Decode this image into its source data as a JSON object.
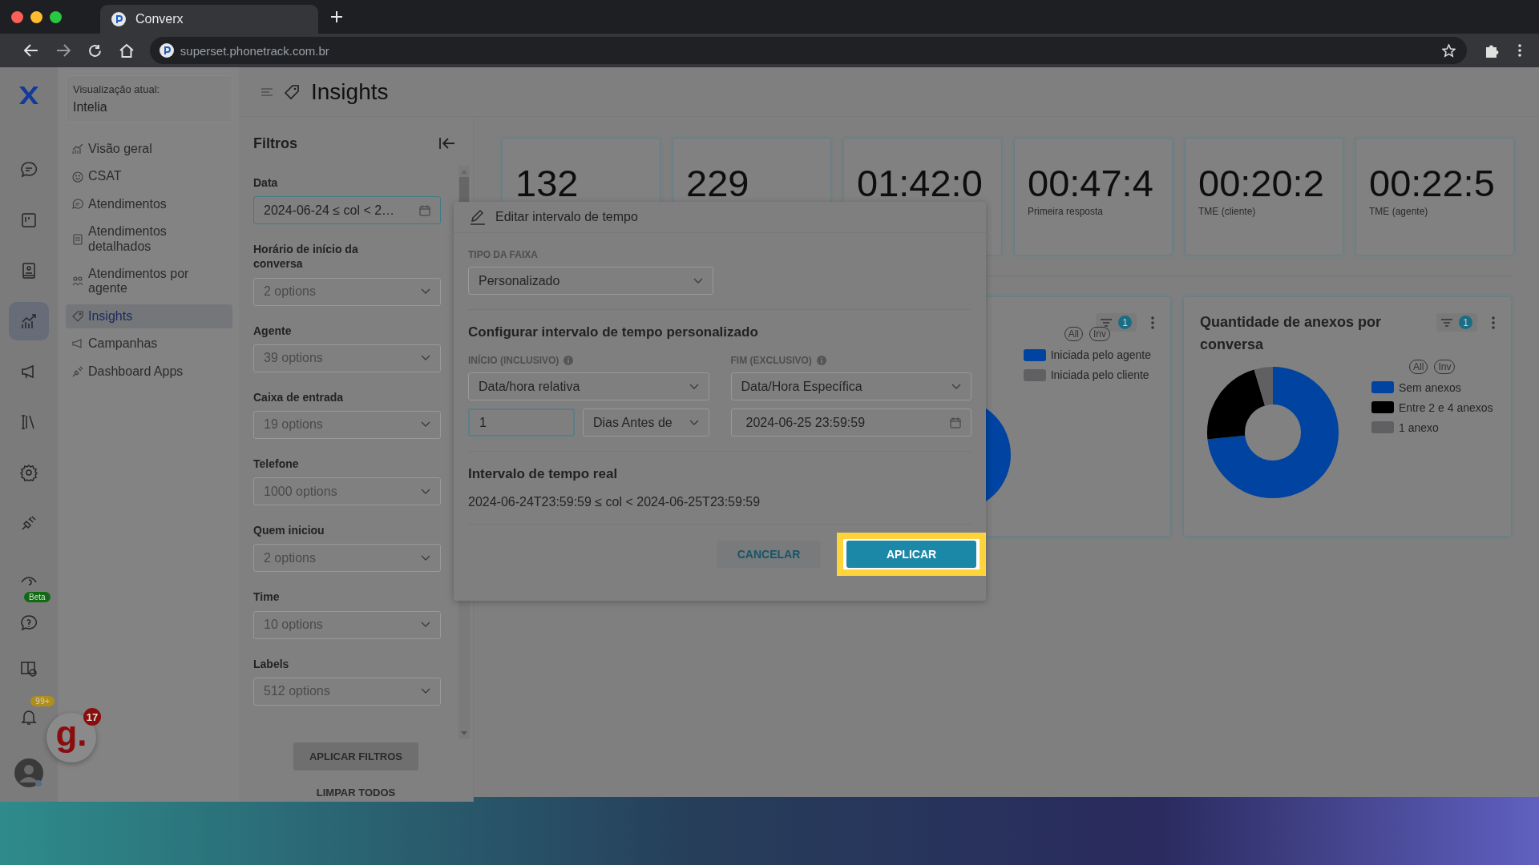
{
  "browser": {
    "tab_title": "Converx",
    "url": "superset.phonetrack.com.br"
  },
  "rail": [
    {
      "selected": false
    },
    {
      "selected": false
    },
    {
      "selected": false
    },
    {
      "selected": true
    },
    {
      "selected": false
    },
    {
      "selected": false
    },
    {
      "selected": false
    },
    {
      "selected": false
    },
    {
      "selected": false,
      "badge": "Beta",
      "color": "#0f6a12"
    },
    {
      "selected": false
    },
    {
      "selected": false
    },
    {
      "selected": false,
      "badge": "99+",
      "color": "#b08e1a"
    }
  ],
  "widget": {
    "logo": "g.",
    "count": "17"
  },
  "nav": {
    "view_label": "Visualização atual:",
    "view_name": "Intelia",
    "items": [
      {
        "label": "Visão geral",
        "selected": false
      },
      {
        "label": "CSAT",
        "selected": false
      },
      {
        "label": "Atendimentos",
        "selected": false
      },
      {
        "label": "Atendimentos detalhados",
        "selected": false
      },
      {
        "label": "Atendimentos por agente",
        "selected": false
      },
      {
        "label": "Insights",
        "selected": true
      },
      {
        "label": "Campanhas",
        "selected": false
      },
      {
        "label": "Dashboard Apps",
        "selected": false
      }
    ]
  },
  "header": {
    "title": "Insights"
  },
  "filters": {
    "title": "Filtros",
    "fields": [
      {
        "label": "Data",
        "value": "2024-06-24 ≤ col < 2…",
        "kind": "date"
      },
      {
        "label": "Horário de início da conversa",
        "placeholder": "2 options",
        "kind": "select"
      },
      {
        "label": "Agente",
        "placeholder": "39 options",
        "kind": "select"
      },
      {
        "label": "Caixa de entrada",
        "placeholder": "19 options",
        "kind": "select"
      },
      {
        "label": "Telefone",
        "placeholder": "1000 options",
        "kind": "select"
      },
      {
        "label": "Quem iniciou",
        "placeholder": "2 options",
        "kind": "select"
      },
      {
        "label": "Time",
        "placeholder": "10 options",
        "kind": "select"
      },
      {
        "label": "Labels",
        "placeholder": "512 options",
        "kind": "select"
      }
    ],
    "apply_button": "APLICAR FILTROS",
    "clear_button": "LIMPAR TODOS"
  },
  "kpis": [
    {
      "value": "132"
    },
    {
      "value": "229"
    },
    {
      "value": "01:42:0"
    },
    {
      "value": "00:47:4",
      "label": "Primeira resposta"
    },
    {
      "value": "00:20:2",
      "label": "TME (cliente)"
    },
    {
      "value": "00:22:5",
      "label": "TME (agente)"
    }
  ],
  "charts": [
    {
      "filter_count": "1",
      "all": "All",
      "inv": "Inv",
      "legend": [
        {
          "label": "Iniciada pelo agente",
          "color": "#0043a0"
        },
        {
          "label": "Iniciada pelo cliente",
          "color": "#606062"
        }
      ]
    },
    {
      "title": "Quantidade de anexos por conversa",
      "filter_count": "1",
      "all": "All",
      "inv": "Inv",
      "legend": [
        {
          "label": "Sem anexos",
          "color": "#0043a0"
        },
        {
          "label": "Entre 2 e 4 anexos",
          "color": "#000000"
        },
        {
          "label": "1 anexo",
          "color": "#606062"
        }
      ]
    }
  ],
  "modal": {
    "title": "Editar intervalo de tempo",
    "range_type_label": "TIPO DA FAIXA",
    "range_type": "Personalizado",
    "section_title": "Configurar intervalo de tempo personalizado",
    "start_label": "INÍCIO (INCLUSIVO)",
    "end_label": "FIM (EXCLUSIVO)",
    "start_mode": "Data/hora relativa",
    "end_mode": "Data/Hora Específica",
    "start_amount": "1",
    "start_unit": "Dias Antes de",
    "end_value": "2024-06-25 23:59:59",
    "actual_title": "Intervalo de tempo real",
    "actual_value": "2024-06-24T23:59:59 ≤ col < 2024-06-25T23:59:59",
    "cancel_button": "CANCELAR",
    "apply_button": "APLICAR",
    "apply_highlighted": true
  }
}
